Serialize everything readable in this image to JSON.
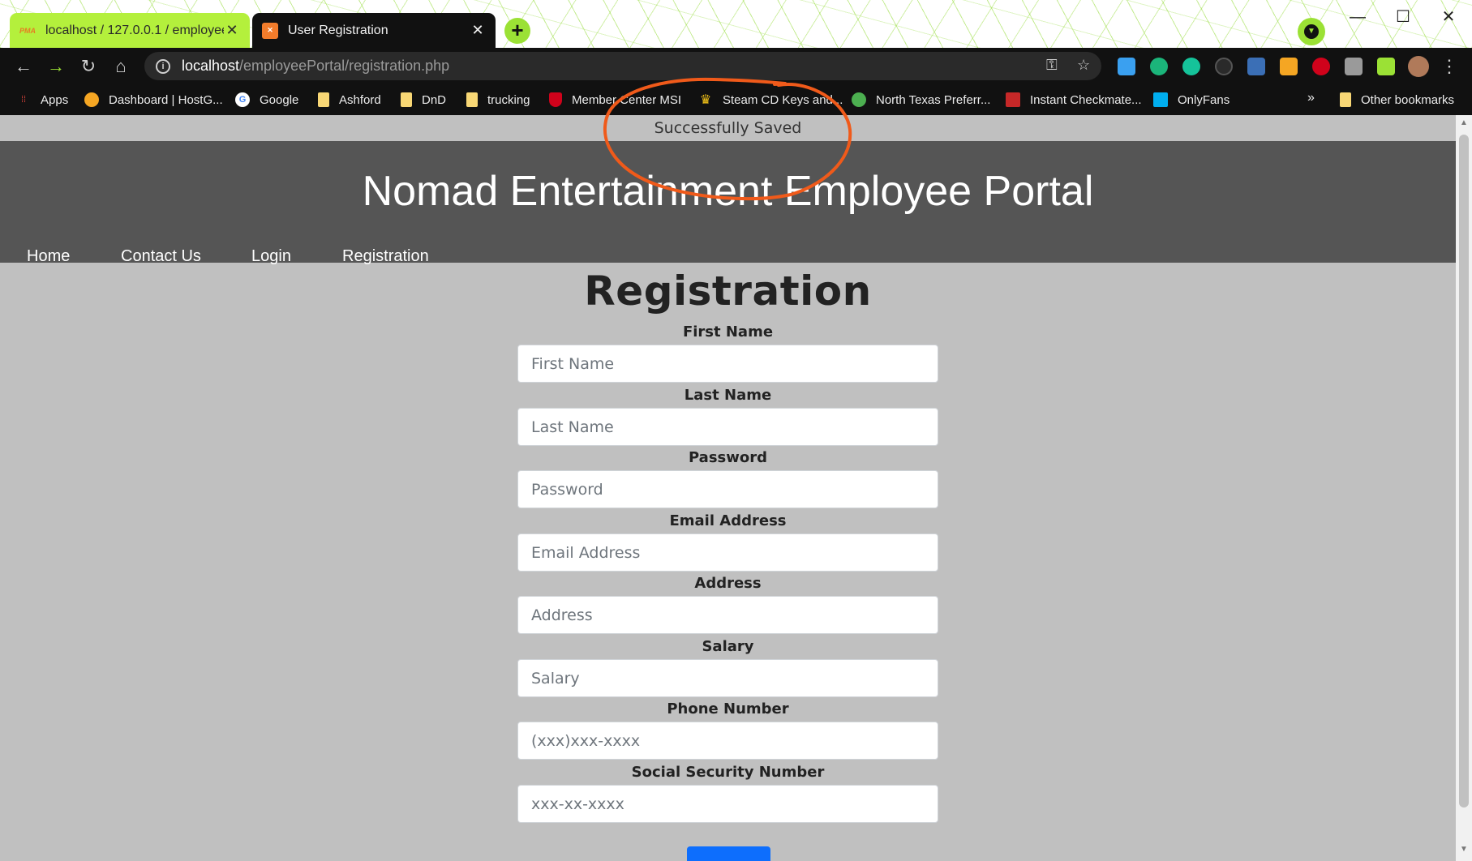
{
  "browser": {
    "tabs": [
      {
        "title": "localhost / 127.0.0.1 / employeep",
        "favicon": "pma-icon",
        "active": false
      },
      {
        "title": "User Registration",
        "favicon": "xampp-icon",
        "active": true
      }
    ],
    "new_tab_label": "+",
    "address": {
      "host": "localhost",
      "path": "/employeePortal/registration.php"
    },
    "bookmarks": [
      {
        "label": "Apps",
        "icon": "apps-grid-icon"
      },
      {
        "label": "Dashboard | HostG...",
        "icon": "hostgator-icon"
      },
      {
        "label": "Google",
        "icon": "google-icon"
      },
      {
        "label": "Ashford",
        "icon": "folder-icon"
      },
      {
        "label": "DnD",
        "icon": "folder-icon"
      },
      {
        "label": "trucking",
        "icon": "folder-icon"
      },
      {
        "label": "Member Center MSI",
        "icon": "msi-shield-icon"
      },
      {
        "label": "Steam CD Keys and...",
        "icon": "crown-icon"
      },
      {
        "label": "North Texas Preferr...",
        "icon": "globe-icon"
      },
      {
        "label": "Instant Checkmate...",
        "icon": "checkmate-icon"
      },
      {
        "label": "OnlyFans",
        "icon": "onlyfans-icon"
      }
    ],
    "more_bookmarks": "»",
    "other_bookmarks": "Other bookmarks",
    "accent_color": "#9be135"
  },
  "page": {
    "flash_message": "Successfully Saved",
    "site_title": "Nomad Entertainment Employee Portal",
    "nav": [
      "Home",
      "Contact Us",
      "Login",
      "Registration"
    ],
    "form_title": "Registration",
    "fields": [
      {
        "label": "First Name",
        "placeholder": "First Name",
        "value": ""
      },
      {
        "label": "Last Name",
        "placeholder": "Last Name",
        "value": ""
      },
      {
        "label": "Password",
        "placeholder": "Password",
        "value": ""
      },
      {
        "label": "Email Address",
        "placeholder": "Email Address",
        "value": ""
      },
      {
        "label": "Address",
        "placeholder": "Address",
        "value": ""
      },
      {
        "label": "Salary",
        "placeholder": "Salary",
        "value": ""
      },
      {
        "label": "Phone Number",
        "placeholder": "(xxx)xxx-xxxx",
        "value": ""
      },
      {
        "label": "Social Security Number",
        "placeholder": "xxx-xx-xxxx",
        "value": ""
      }
    ],
    "header_color": "#555555",
    "background_color": "#c0c0c0",
    "button_color": "#0d6efd",
    "annotation_color": "#f05a1a"
  }
}
